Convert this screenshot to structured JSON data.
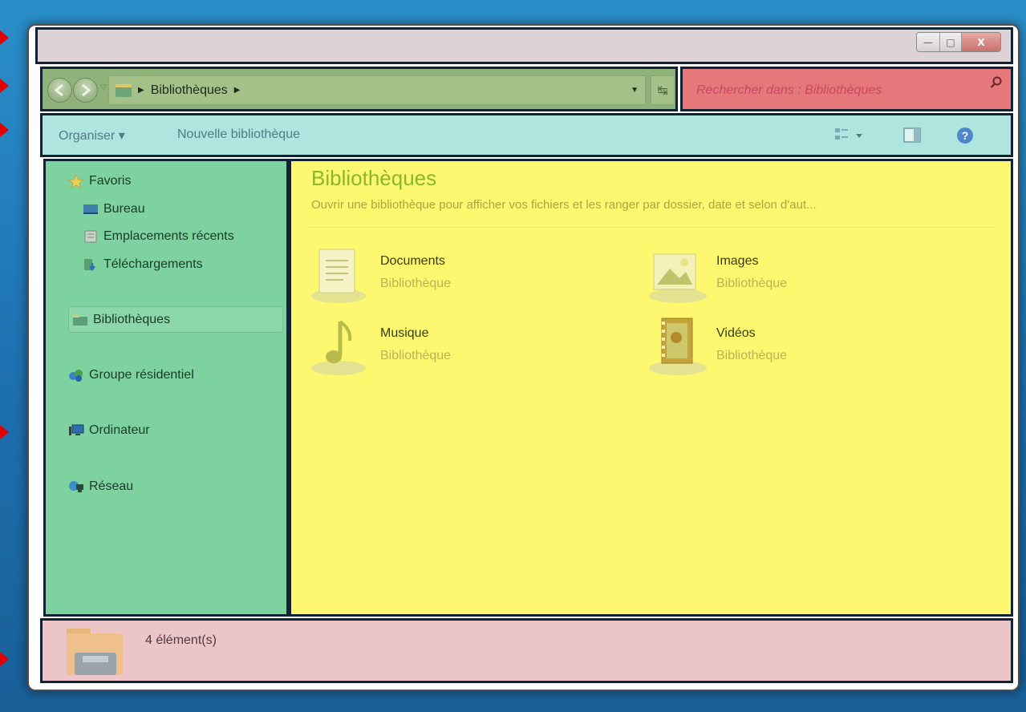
{
  "window": {
    "controls": {
      "minimize": "—",
      "maximize": "□",
      "close": "X"
    }
  },
  "nav": {
    "back_icon": "back-arrow-icon",
    "forward_icon": "forward-arrow-icon",
    "address": {
      "crumb": "Bibliothèques"
    },
    "refresh_icon": "refresh-icon"
  },
  "search": {
    "placeholder": "Rechercher dans : Bibliothèques"
  },
  "toolbar": {
    "organize": "Organiser ▾",
    "new_library": "Nouvelle bibliothèque",
    "view_icon": "view-options-icon",
    "preview_icon": "preview-pane-icon",
    "help_icon": "help-icon"
  },
  "sidebar": {
    "favorites": {
      "label": "Favoris",
      "items": [
        {
          "label": "Bureau",
          "icon": "desktop-icon"
        },
        {
          "label": "Emplacements récents",
          "icon": "recent-places-icon"
        },
        {
          "label": "Téléchargements",
          "icon": "downloads-icon"
        }
      ]
    },
    "libraries": "Bibliothèques",
    "homegroup": "Groupe résidentiel",
    "computer": "Ordinateur",
    "network": "Réseau"
  },
  "content": {
    "title": "Bibliothèques",
    "description": "Ouvrir une bibliothèque pour afficher vos fichiers et les ranger par dossier, date et selon d'aut...",
    "libraries": [
      {
        "name": "Documents",
        "type": "Bibliothèque",
        "icon": "documents-library-icon"
      },
      {
        "name": "Images",
        "type": "Bibliothèque",
        "icon": "pictures-library-icon"
      },
      {
        "name": "Musique",
        "type": "Bibliothèque",
        "icon": "music-library-icon"
      },
      {
        "name": "Vidéos",
        "type": "Bibliothèque",
        "icon": "videos-library-icon"
      }
    ]
  },
  "status": {
    "count": "4 élément(s)"
  },
  "colors": {
    "titlebar": "#ddd2d4",
    "navbar": "#8fb27a",
    "search": "#e6787c",
    "toolbar": "#aee6df",
    "navpane": "#7dd29f",
    "content": "#fdf870",
    "statusbar": "#ecc5c9",
    "arrow": "#e00000"
  }
}
